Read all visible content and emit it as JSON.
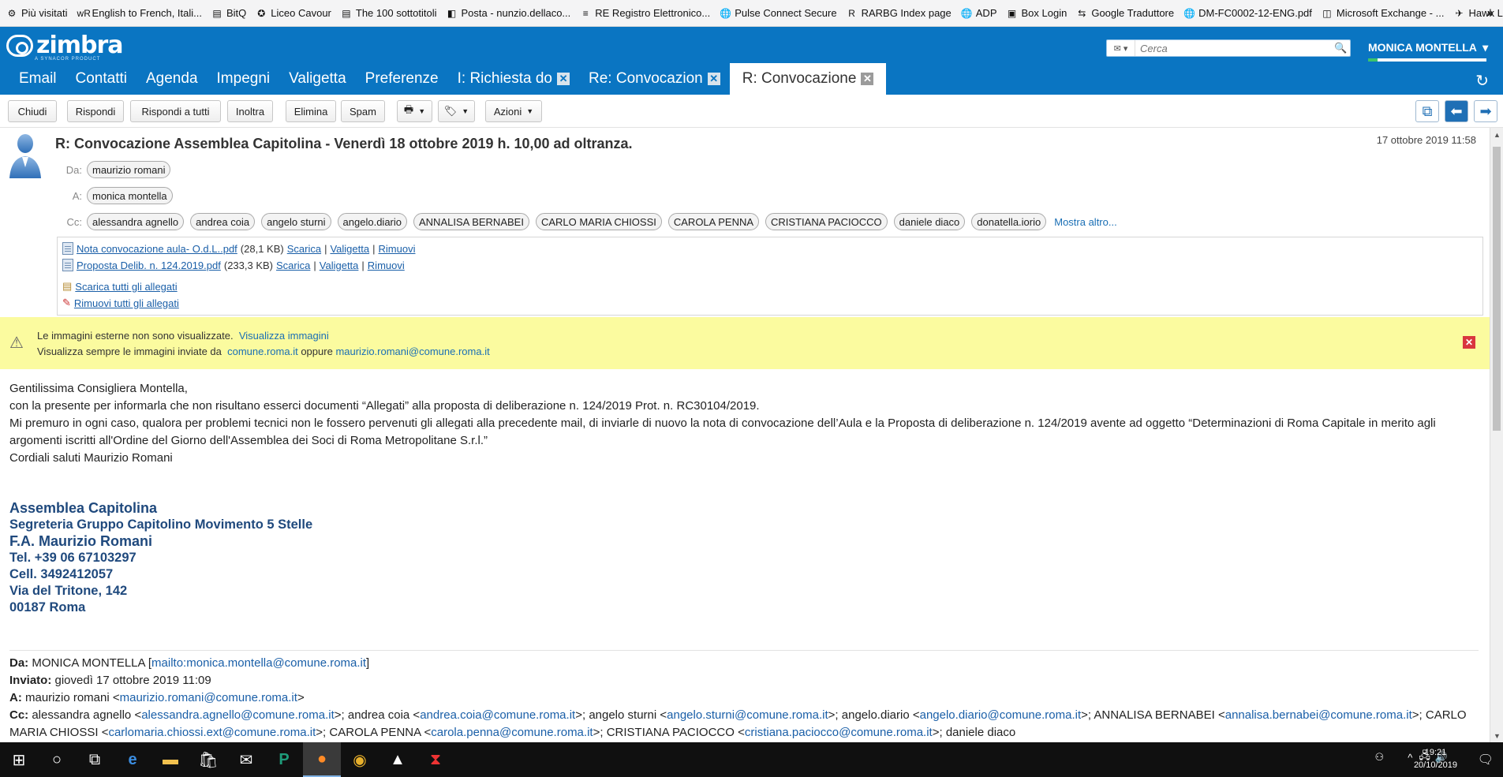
{
  "bookmarks": [
    {
      "icon": "gear",
      "label": "Più visitati"
    },
    {
      "icon": "wr",
      "label": "English to French, Itali..."
    },
    {
      "icon": "doc",
      "label": "BitQ"
    },
    {
      "icon": "seal",
      "label": "Liceo Cavour"
    },
    {
      "icon": "doc",
      "label": "The 100 sottotitoli"
    },
    {
      "icon": "outlook",
      "label": "Posta - nunzio.dellaco..."
    },
    {
      "icon": "re",
      "label": "RE Registro Elettronico..."
    },
    {
      "icon": "globe",
      "label": "Pulse Connect Secure"
    },
    {
      "icon": "r",
      "label": "RARBG Index page"
    },
    {
      "icon": "globe",
      "label": "ADP"
    },
    {
      "icon": "box",
      "label": "Box Login"
    },
    {
      "icon": "translate",
      "label": "Google Traduttore"
    },
    {
      "icon": "globe",
      "label": "DM-FC0002-12-ENG.pdf"
    },
    {
      "icon": "exchange",
      "label": "Microsoft Exchange - ..."
    },
    {
      "icon": "hawk",
      "label": "Hawk Legend Downlo..."
    }
  ],
  "header": {
    "logo": "zimbra",
    "logo_sub": "A SYNACOR PRODUCT",
    "search_placeholder": "Cerca",
    "user": "MONICA MONTELLA"
  },
  "tabs": [
    {
      "label": "Email",
      "closable": false
    },
    {
      "label": "Contatti",
      "closable": false
    },
    {
      "label": "Agenda",
      "closable": false
    },
    {
      "label": "Impegni",
      "closable": false
    },
    {
      "label": "Valigetta",
      "closable": false
    },
    {
      "label": "Preferenze",
      "closable": false
    },
    {
      "label": "I: Richiesta do",
      "closable": true
    },
    {
      "label": "Re: Convocazion",
      "closable": true
    },
    {
      "label": "R: Convocazione",
      "closable": true,
      "active": true
    }
  ],
  "toolbar": {
    "close": "Chiudi",
    "reply": "Rispondi",
    "reply_all": "Rispondi a tutti",
    "forward": "Inoltra",
    "delete": "Elimina",
    "spam": "Spam",
    "actions": "Azioni"
  },
  "message": {
    "subject": "R: Convocazione Assemblea Capitolina - Venerdì 18 ottobre 2019 h. 10,00 ad oltranza.",
    "date": "17 ottobre 2019 11:58",
    "from_label": "Da:",
    "from": "maurizio romani",
    "to_label": "A:",
    "to": "monica montella",
    "cc_label": "Cc:",
    "cc": [
      "alessandra agnello",
      "andrea coia",
      "angelo sturni",
      "angelo.diario",
      "ANNALISA BERNABEI",
      "CARLO MARIA CHIOSSI",
      "CAROLA PENNA",
      "CRISTIANA PACIOCCO",
      "daniele diaco",
      "donatella.iorio"
    ],
    "show_more": "Mostra altro...",
    "attachments": [
      {
        "name": "Nota convocazione aula- O.d.L..pdf",
        "size": "(28,1 KB)"
      },
      {
        "name": "Proposta Delib. n. 124.2019.pdf",
        "size": "(233,3 KB)"
      }
    ],
    "att_download": "Scarica",
    "att_briefcase": "Valigetta",
    "att_remove": "Rimuovi",
    "download_all": "Scarica tutti gli allegati",
    "remove_all": "Rimuovi tutti gli allegati"
  },
  "warning": {
    "line1": "Le immagini esterne non sono visualizzate.",
    "line1_link": "Visualizza immagini",
    "line2_prefix": "Visualizza sempre le immagini inviate da",
    "domain": "comune.roma.it",
    "line2_or": "oppure",
    "email": "maurizio.romani@comune.roma.it"
  },
  "body": {
    "p1": "Gentilissima Consigliera Montella,",
    "p2": "con la presente per informarla che non risultano esserci documenti “Allegati” alla proposta di deliberazione n. 124/2019 Prot. n. RC30104/2019.",
    "p3": "Mi premuro in ogni caso, qualora per problemi tecnici non le fossero pervenuti gli allegati alla precedente mail, di inviarle di nuovo la nota di convocazione dell’Aula e la Proposta di deliberazione n. 124/2019 avente ad oggetto “Determinazioni di Roma Capitale in merito agli argomenti iscritti all'Ordine del Giorno dell'Assemblea dei Soci di Roma Metropolitane S.r.l.”",
    "p4": "Cordiali saluti  Maurizio Romani"
  },
  "signature": {
    "l1": "Assemblea Capitolina",
    "l2": "Segreteria Gruppo Capitolino Movimento 5 Stelle",
    "l3": "F.A. Maurizio Romani",
    "l4": "Tel. +39 06 67103297",
    "l5": "Cell. 3492412057",
    "l6": "Via del Tritone, 142",
    "l7": "00187  Roma"
  },
  "quoted": {
    "da_label": "Da:",
    "da_name": " MONICA MONTELLA [",
    "da_mail": "mailto:monica.montella@comune.roma.it",
    "inviato_label": "Inviato:",
    "inviato": " giovedì 17 ottobre 2019 11:09",
    "a_label": "A:",
    "a_name": " maurizio romani <",
    "a_mail": "maurizio.romani@comune.roma.it",
    "cc_label": "Cc:",
    "cc_list": [
      {
        "name": "alessandra agnello",
        "mail": "alessandra.agnello@comune.roma.it"
      },
      {
        "name": "andrea coia",
        "mail": "andrea.coia@comune.roma.it"
      },
      {
        "name": "angelo sturni",
        "mail": "angelo.sturni@comune.roma.it"
      },
      {
        "name": "angelo.diario",
        "mail": "angelo.diario@comune.roma.it"
      },
      {
        "name": "ANNALISA BERNABEI",
        "mail": "annalisa.bernabei@comune.roma.it"
      },
      {
        "name": "CARLO MARIA CHIOSSI",
        "mail": "carlomaria.chiossi.ext@comune.roma.it"
      },
      {
        "name": "CAROLA PENNA",
        "mail": "carola.penna@comune.roma.it"
      },
      {
        "name": "CRISTIANA PACIOCCO",
        "mail": "cristiana.paciocco@comune.roma.it"
      }
    ],
    "cc_tail": "daniele diaco"
  },
  "taskbar": {
    "time": "19:21",
    "date": "20/10/2019"
  }
}
